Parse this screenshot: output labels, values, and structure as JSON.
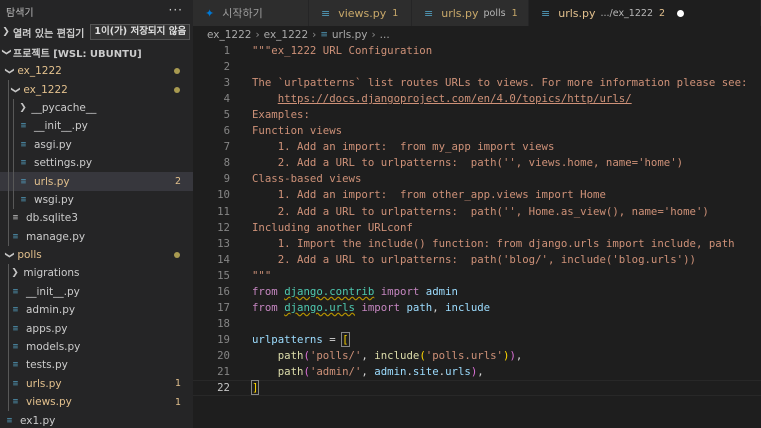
{
  "sidebar": {
    "title": "탐색기",
    "more": "···",
    "open_editors": {
      "label": "열려 있는 편집기",
      "badge": "1이(가) 저장되지 않음"
    },
    "project": {
      "label": "프로젝트 [WSL: UBUNTU]"
    },
    "tree": [
      {
        "label": "ex_1222",
        "type": "folder",
        "open": true,
        "depth": 0,
        "color": "#e2c08d",
        "marker": "dot"
      },
      {
        "label": "ex_1222",
        "type": "folder",
        "open": true,
        "depth": 1,
        "color": "#e2c08d",
        "marker": "dot"
      },
      {
        "label": "__pycache__",
        "type": "folder",
        "open": false,
        "depth": 2,
        "color": "#cccccc"
      },
      {
        "label": "__init__.py",
        "type": "py",
        "depth": 2,
        "color": "#cccccc"
      },
      {
        "label": "asgi.py",
        "type": "py",
        "depth": 2,
        "color": "#cccccc"
      },
      {
        "label": "settings.py",
        "type": "py",
        "depth": 2,
        "color": "#cccccc"
      },
      {
        "label": "urls.py",
        "type": "py",
        "depth": 2,
        "color": "#e2c08d",
        "badge": "2",
        "active": true
      },
      {
        "label": "wsgi.py",
        "type": "py",
        "depth": 2,
        "color": "#cccccc"
      },
      {
        "label": "db.sqlite3",
        "type": "db",
        "depth": 1,
        "color": "#cccccc"
      },
      {
        "label": "manage.py",
        "type": "py",
        "depth": 1,
        "color": "#cccccc"
      },
      {
        "label": "polls",
        "type": "folder",
        "open": true,
        "depth": 0,
        "color": "#e2c08d",
        "marker": "dot"
      },
      {
        "label": "migrations",
        "type": "folder",
        "open": false,
        "depth": 1,
        "color": "#cccccc"
      },
      {
        "label": "__init__.py",
        "type": "py",
        "depth": 1,
        "color": "#cccccc"
      },
      {
        "label": "admin.py",
        "type": "py",
        "depth": 1,
        "color": "#cccccc"
      },
      {
        "label": "apps.py",
        "type": "py",
        "depth": 1,
        "color": "#cccccc"
      },
      {
        "label": "models.py",
        "type": "py",
        "depth": 1,
        "color": "#cccccc"
      },
      {
        "label": "tests.py",
        "type": "py",
        "depth": 1,
        "color": "#cccccc"
      },
      {
        "label": "urls.py",
        "type": "py",
        "depth": 1,
        "color": "#e2c08d",
        "badge": "1"
      },
      {
        "label": "views.py",
        "type": "py",
        "depth": 1,
        "color": "#e2c08d",
        "badge": "1"
      },
      {
        "label": "ex1.py",
        "type": "py",
        "depth": 0,
        "color": "#cccccc"
      }
    ]
  },
  "tabs": [
    {
      "label": "시작하기",
      "icon": "vscode-icon",
      "active": false
    },
    {
      "label": "views.py",
      "icon": "python-icon",
      "badge": "1",
      "active": false
    },
    {
      "label": "urls.py",
      "icon": "python-icon",
      "desc": "polls",
      "badge": "1",
      "active": false
    },
    {
      "label": "urls.py",
      "icon": "python-icon",
      "desc": ".../ex_1222",
      "badge": "2",
      "active": true,
      "dirty": true
    }
  ],
  "breadcrumb": [
    "ex_1222",
    "ex_1222",
    "urls.py",
    "..."
  ],
  "colors": {
    "modified": "#e2c08d",
    "python_icon": "#519aba",
    "accent_blue": "#0078d4"
  },
  "editor": {
    "current_line": 22,
    "lines": [
      [
        [
          "t-doc",
          "\"\"\"ex_1222 URL Configuration"
        ]
      ],
      [],
      [
        [
          "t-doc",
          "The `urlpatterns` list routes URLs to views. For more information please see:"
        ]
      ],
      [
        [
          "t-doc",
          "    "
        ],
        [
          "t-link",
          "https://docs.djangoproject.com/en/4.0/topics/http/urls/"
        ]
      ],
      [
        [
          "t-doc",
          "Examples:"
        ]
      ],
      [
        [
          "t-doc",
          "Function views"
        ]
      ],
      [
        [
          "t-doc",
          "    1. Add an import:  from my_app import views"
        ]
      ],
      [
        [
          "t-doc",
          "    2. Add a URL to urlpatterns:  path('', views.home, name='home')"
        ]
      ],
      [
        [
          "t-doc",
          "Class-based views"
        ]
      ],
      [
        [
          "t-doc",
          "    1. Add an import:  from other_app.views import Home"
        ]
      ],
      [
        [
          "t-doc",
          "    2. Add a URL to urlpatterns:  path('', Home.as_view(), name='home')"
        ]
      ],
      [
        [
          "t-doc",
          "Including another URLconf"
        ]
      ],
      [
        [
          "t-doc",
          "    1. Import the include() function: from django.urls import include, path"
        ]
      ],
      [
        [
          "t-doc",
          "    2. Add a URL to urlpatterns:  path('blog/', include('blog.urls'))"
        ]
      ],
      [
        [
          "t-doc",
          "\"\"\""
        ]
      ],
      [
        [
          "t-kw",
          "from"
        ],
        [
          "t-plain",
          " "
        ],
        [
          "t-mod",
          "django.contrib"
        ],
        [
          "t-plain",
          " "
        ],
        [
          "t-kw",
          "import"
        ],
        [
          "t-plain",
          " "
        ],
        [
          "t-var",
          "admin"
        ]
      ],
      [
        [
          "t-kw",
          "from"
        ],
        [
          "t-plain",
          " "
        ],
        [
          "t-mod",
          "django.urls"
        ],
        [
          "t-plain",
          " "
        ],
        [
          "t-kw",
          "import"
        ],
        [
          "t-plain",
          " "
        ],
        [
          "t-var",
          "path"
        ],
        [
          "t-plain",
          ", "
        ],
        [
          "t-var",
          "include"
        ]
      ],
      [],
      [
        [
          "t-var",
          "urlpatterns"
        ],
        [
          "t-plain",
          " = "
        ],
        [
          "t-brbox",
          "["
        ]
      ],
      [
        [
          "t-plain",
          "    "
        ],
        [
          "t-fn",
          "path"
        ],
        [
          "t-br2",
          "("
        ],
        [
          "t-str",
          "'polls/'"
        ],
        [
          "t-plain",
          ", "
        ],
        [
          "t-fn",
          "include"
        ],
        [
          "t-br",
          "("
        ],
        [
          "t-str",
          "'polls.urls'"
        ],
        [
          "t-br",
          ")"
        ],
        [
          "t-br2",
          ")"
        ],
        [
          "t-plain",
          ","
        ]
      ],
      [
        [
          "t-plain",
          "    "
        ],
        [
          "t-fn",
          "path"
        ],
        [
          "t-br2",
          "("
        ],
        [
          "t-str",
          "'admin/'"
        ],
        [
          "t-plain",
          ", "
        ],
        [
          "t-var",
          "admin"
        ],
        [
          "t-plain",
          "."
        ],
        [
          "t-var",
          "site"
        ],
        [
          "t-plain",
          "."
        ],
        [
          "t-var",
          "urls"
        ],
        [
          "t-br2",
          ")"
        ],
        [
          "t-plain",
          ","
        ]
      ],
      [
        [
          "t-brbox",
          "]"
        ]
      ]
    ]
  }
}
